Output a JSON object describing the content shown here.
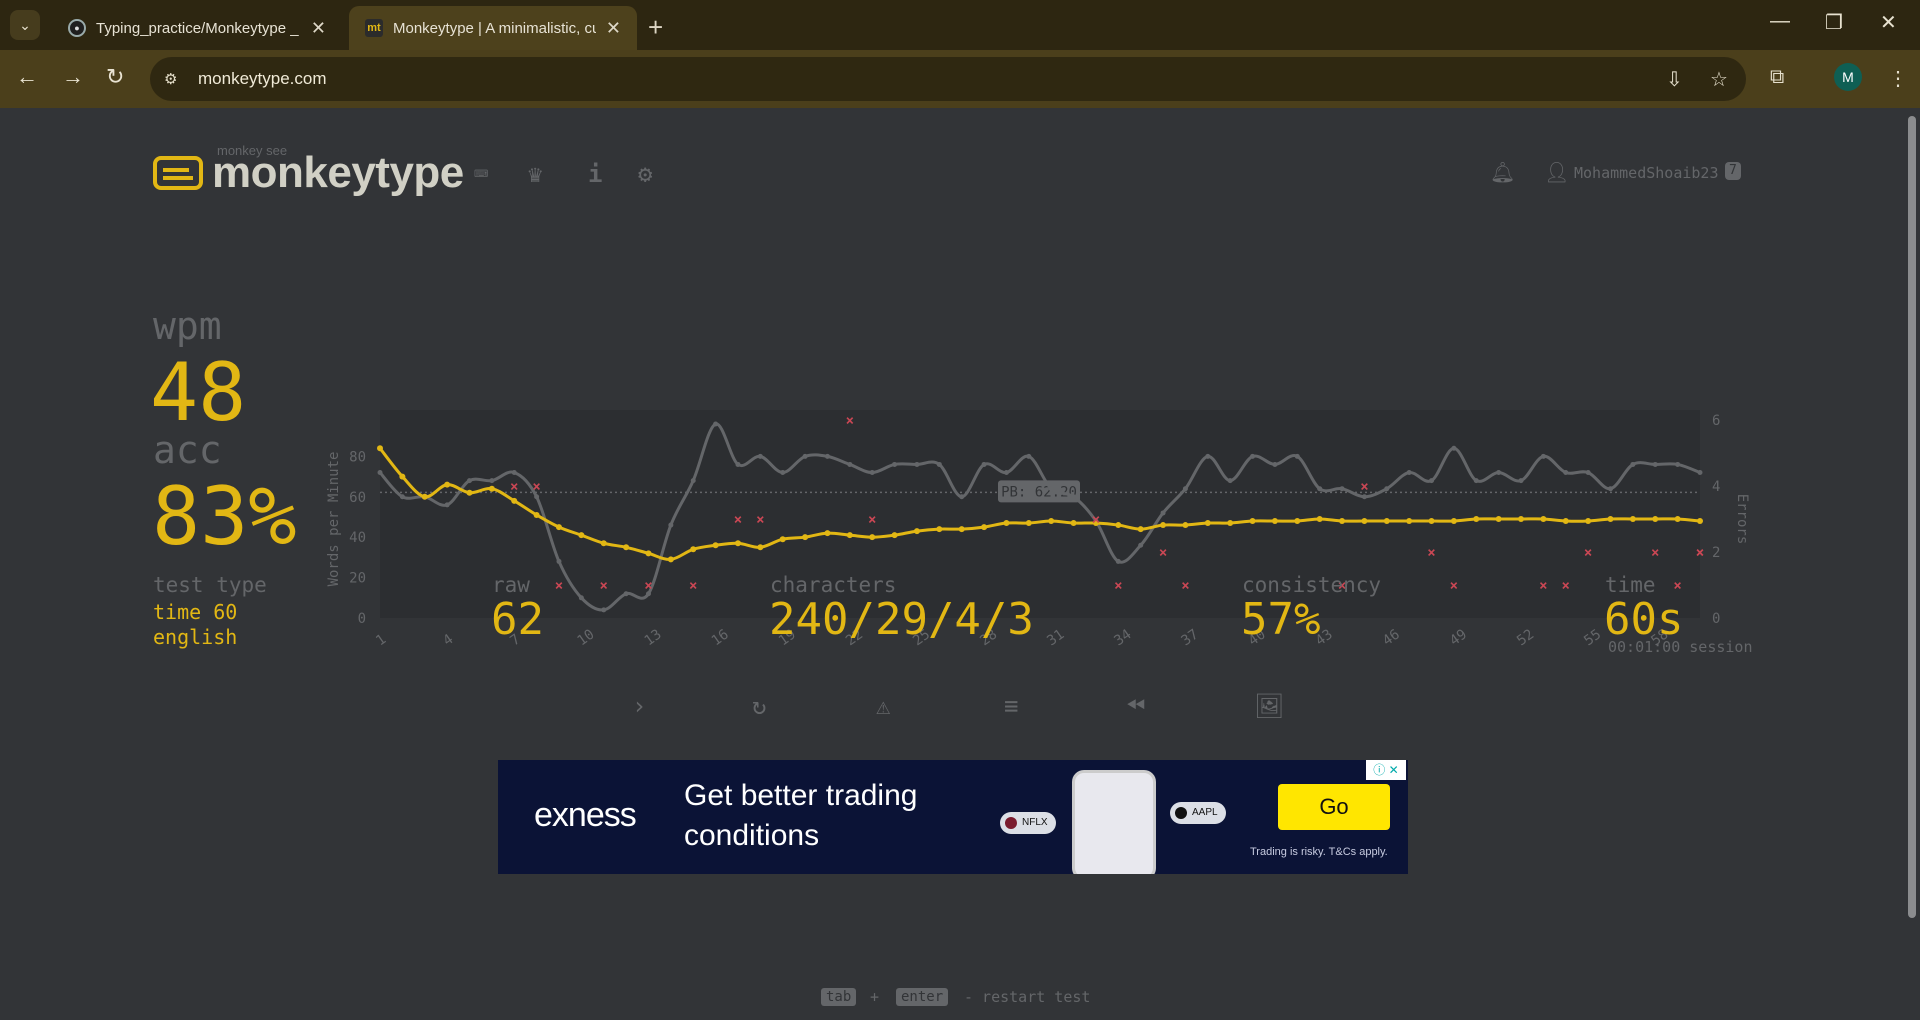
{
  "browser": {
    "tabs": [
      {
        "title": "Typing_practice/Monkeytype _ /",
        "active": false
      },
      {
        "title": "Monkeytype | A minimalistic, cu",
        "active": true
      }
    ],
    "url": "monkeytype.com",
    "profile_initial": "M",
    "favicon_mt": "mt"
  },
  "header": {
    "logo_sub": "monkey see",
    "logo_text": "monkeytype",
    "username": "MohammedShoaib23",
    "level": "7"
  },
  "result": {
    "wpm_label": "wpm",
    "wpm": "48",
    "acc_label": "acc",
    "acc": "83%",
    "test_type_label": "test type",
    "test_type": "time 60",
    "language": "english",
    "raw_label": "raw",
    "raw": "62",
    "characters_label": "characters",
    "characters": "240/29/4/3",
    "consistency_label": "consistency",
    "consistency": "57%",
    "time_label": "time",
    "time": "60s",
    "session": "00:01:00 session"
  },
  "chart_data": {
    "type": "line",
    "ylabel": "Words per Minute",
    "y2label": "Errors",
    "ylim": [
      0,
      98
    ],
    "y2lim": [
      0,
      6
    ],
    "yticks": [
      "0",
      "20",
      "40",
      "60",
      "80"
    ],
    "y2ticks": [
      "0",
      "2",
      "4",
      "6"
    ],
    "xticks": [
      "1",
      "4",
      "7",
      "10",
      "13",
      "16",
      "19",
      "22",
      "25",
      "28",
      "31",
      "34",
      "37",
      "40",
      "43",
      "46",
      "49",
      "52",
      "55",
      "58"
    ],
    "pb_label": "PB: 62.20",
    "pb_value": 62.2,
    "x": [
      1,
      2,
      3,
      4,
      5,
      6,
      7,
      8,
      9,
      10,
      11,
      12,
      13,
      14,
      15,
      16,
      17,
      18,
      19,
      20,
      21,
      22,
      23,
      24,
      25,
      26,
      27,
      28,
      29,
      30,
      31,
      32,
      33,
      34,
      35,
      36,
      37,
      38,
      39,
      40,
      41,
      42,
      43,
      44,
      45,
      46,
      47,
      48,
      49,
      50,
      51,
      52,
      53,
      54,
      55,
      56,
      57,
      58,
      59,
      60
    ],
    "series": [
      {
        "role": "raw",
        "color": "#646669",
        "values": [
          72,
          60,
          60,
          56,
          68,
          68,
          72,
          60,
          28,
          10,
          4,
          12,
          12,
          46,
          68,
          96,
          76,
          80,
          72,
          80,
          80,
          76,
          72,
          76,
          76,
          76,
          60,
          76,
          72,
          80,
          64,
          60,
          48,
          28,
          36,
          52,
          64,
          80,
          68,
          80,
          76,
          80,
          64,
          64,
          60,
          64,
          72,
          68,
          84,
          68,
          72,
          68,
          80,
          72,
          72,
          64,
          76,
          76,
          76,
          72
        ]
      },
      {
        "role": "wpm",
        "color": "#e2b714",
        "values": [
          84,
          70,
          60,
          66,
          62,
          64,
          58,
          51,
          45,
          41,
          37,
          35,
          32,
          29,
          34,
          36,
          37,
          35,
          39,
          40,
          42,
          41,
          40,
          41,
          43,
          44,
          44,
          45,
          47,
          47,
          48,
          47,
          47,
          46,
          44,
          46,
          46,
          47,
          47,
          48,
          48,
          48,
          49,
          48,
          48,
          48,
          48,
          48,
          48,
          49,
          49,
          49,
          49,
          48,
          48,
          49,
          49,
          49,
          49,
          48
        ]
      },
      {
        "role": "errors",
        "color": "#ca4754",
        "x": [
          7,
          8,
          9,
          11,
          13,
          15,
          17,
          18,
          22,
          23,
          33,
          34,
          36,
          37,
          44,
          45,
          48,
          49,
          53,
          54,
          55,
          58,
          59,
          60,
          61
        ],
        "values": [
          4,
          4,
          1,
          1,
          1,
          1,
          3,
          3,
          6,
          3,
          3,
          1,
          2,
          1,
          1,
          4,
          2,
          1,
          1,
          1,
          2,
          2,
          1,
          2,
          2
        ]
      }
    ]
  },
  "footer": {
    "key_tab": "tab",
    "plus": "+",
    "key_enter": "enter",
    "hint": "- restart test"
  },
  "ad": {
    "brand": "exness",
    "headline": "Get better trading conditions",
    "pill1": "NFLX",
    "pill2": "AAPL",
    "cta": "Go",
    "disclaimer": "Trading is risky. T&Cs apply."
  }
}
